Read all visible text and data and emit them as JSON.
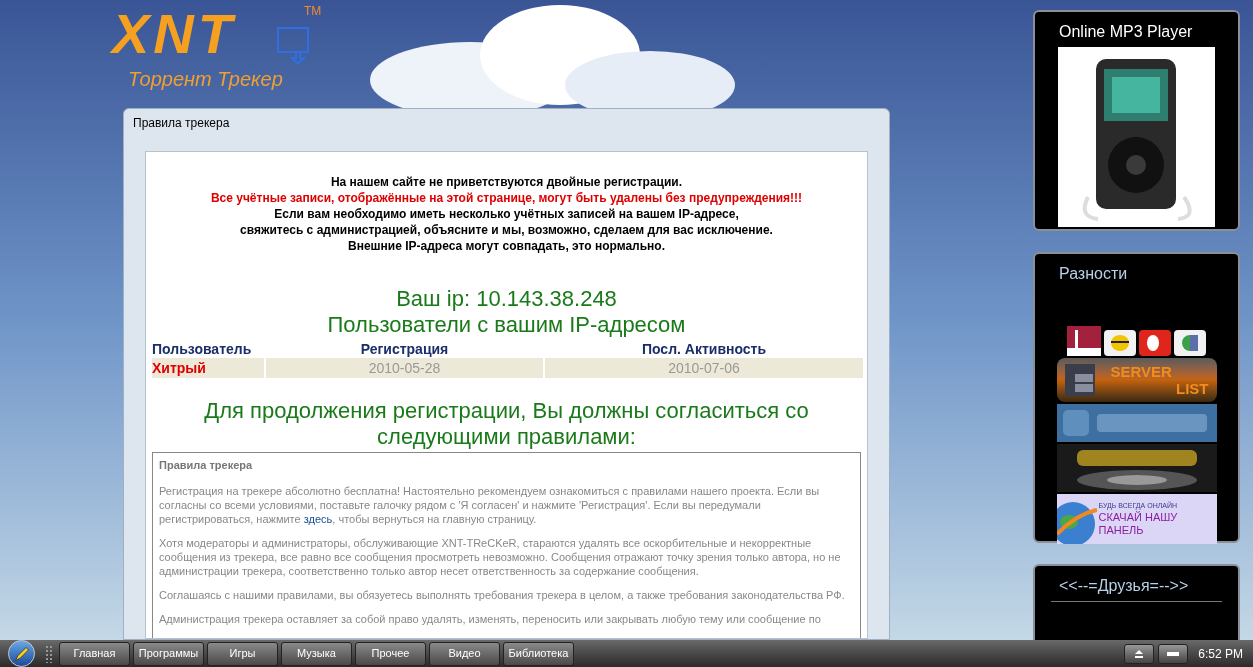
{
  "logo": {
    "name": "XNT",
    "trademark": "TM",
    "tagline": "Торрент Трекер"
  },
  "dialog": {
    "title": "Правила трекера",
    "notice": [
      {
        "kind": "normal",
        "text": "На нашем сайте не приветствуются двойные регистрации."
      },
      {
        "kind": "warning",
        "text": "Все учётные записи, отображённые на этой странице, могут быть удалены без предупреждения!!!"
      },
      {
        "kind": "normal",
        "text": "Если вам необходимо иметь несколько учётных записей на вашем IP-адресе,"
      },
      {
        "kind": "normal",
        "text": "свяжитесь с администрацией, объясните и мы, возможно, сделаем для вас исключение."
      },
      {
        "kind": "normal",
        "text": "Внешние IP-адреса могут совпадать, это нормально."
      }
    ],
    "ip_line": "Ваш ip: 10.143.38.248",
    "users_heading": "Пользователи с вашим IP-адресом",
    "table": {
      "columns": [
        "Пользователь",
        "Регистрация",
        "Посл. Активность"
      ],
      "rows": [
        {
          "cells": [
            "Хитрый",
            "2010-05-28",
            "2010-07-06"
          ]
        }
      ]
    },
    "agree_heading": "Для продолжения регистрации, Вы должны согласиться со следующими правилами:",
    "rules": {
      "title": "Правила трекера",
      "paragraphs": [
        {
          "before": "Регистрация на трекере абсолютно бесплатна! Настоятельно рекомендуем ознакомиться с правилами нашего проекта. Если вы согласны со всеми условиями, поставьте галочку рядом с 'Я согласен' и нажмите 'Регистрация'. Если вы передумали регистрироваться, нажмите ",
          "link": "здесь",
          "after": ", чтобы вернуться на главную страницу."
        },
        {
          "before": "Хотя модераторы и администраторы, обслуживающие XNT-TReCKeR, стараются удалять все оскорбительные и некорректные сообщения из трекера, все равно все сообщения просмотреть невозможно. Сообщения отражают точку зрения только автора, но не администрации трекера, соответственно только автор несет ответственность за содержание сообщения."
        },
        {
          "before": "Соглашаясь с нашими правилами, вы обязуетесь выполнять требования трекера в целом, а также требования законодательства РФ."
        },
        {
          "before": "Администрация трекера оставляет за собой право удалять, изменять, переносить или закрывать любую тему или сообщение по"
        }
      ]
    }
  },
  "sidebar": [
    {
      "kind": "player",
      "title": "Online MP3 Player"
    },
    {
      "kind": "banners",
      "title": "Разности",
      "banners": [
        {
          "kind": "operators"
        },
        {
          "kind": "server",
          "lines": [
            "SERVER",
            "LIST"
          ]
        },
        {
          "kind": "picture"
        },
        {
          "kind": "picture"
        },
        {
          "kind": "promo",
          "lines": [
            "БУДЬ ВСЕГДА ОНЛАЙН",
            "СКАЧАЙ НАШУ",
            "ПАНЕЛЬ"
          ]
        }
      ]
    },
    {
      "kind": "empty",
      "title": "<<--=Друзья=-->>"
    }
  ],
  "taskbar": {
    "buttons": [
      "Главная",
      "Программы",
      "Игры",
      "Музыка",
      "Прочее",
      "Видео",
      "Библиотека"
    ],
    "clock": "6:52 PM"
  }
}
